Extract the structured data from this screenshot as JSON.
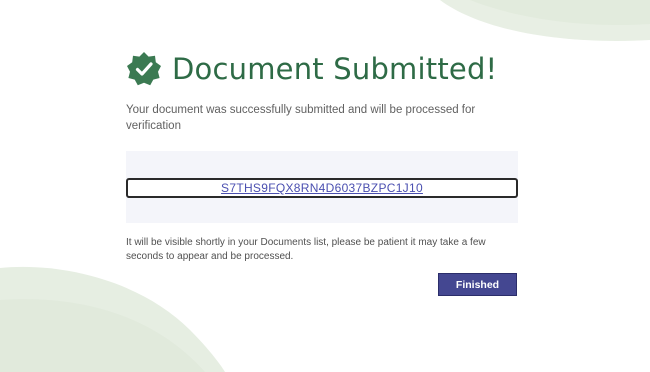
{
  "dialog": {
    "title": "Document Submitted!",
    "subtitle": "Your document was successfully submitted and will be processed for verification",
    "reference_code": "S7THS9FQX8RN4D6037BZPC1J10",
    "note": "It will be visible shortly in your Documents list, please be patient it may take a few seconds to appear and be processed.",
    "finish_label": "Finished"
  },
  "icons": {
    "success_badge": "verified-check-badge-icon"
  },
  "colors": {
    "title_green": "#2e6b46",
    "badge_green": "#3b7a52",
    "button_indigo": "#444791",
    "link_blue": "#4a4fb0",
    "deco_green": "#e3ecdf"
  }
}
